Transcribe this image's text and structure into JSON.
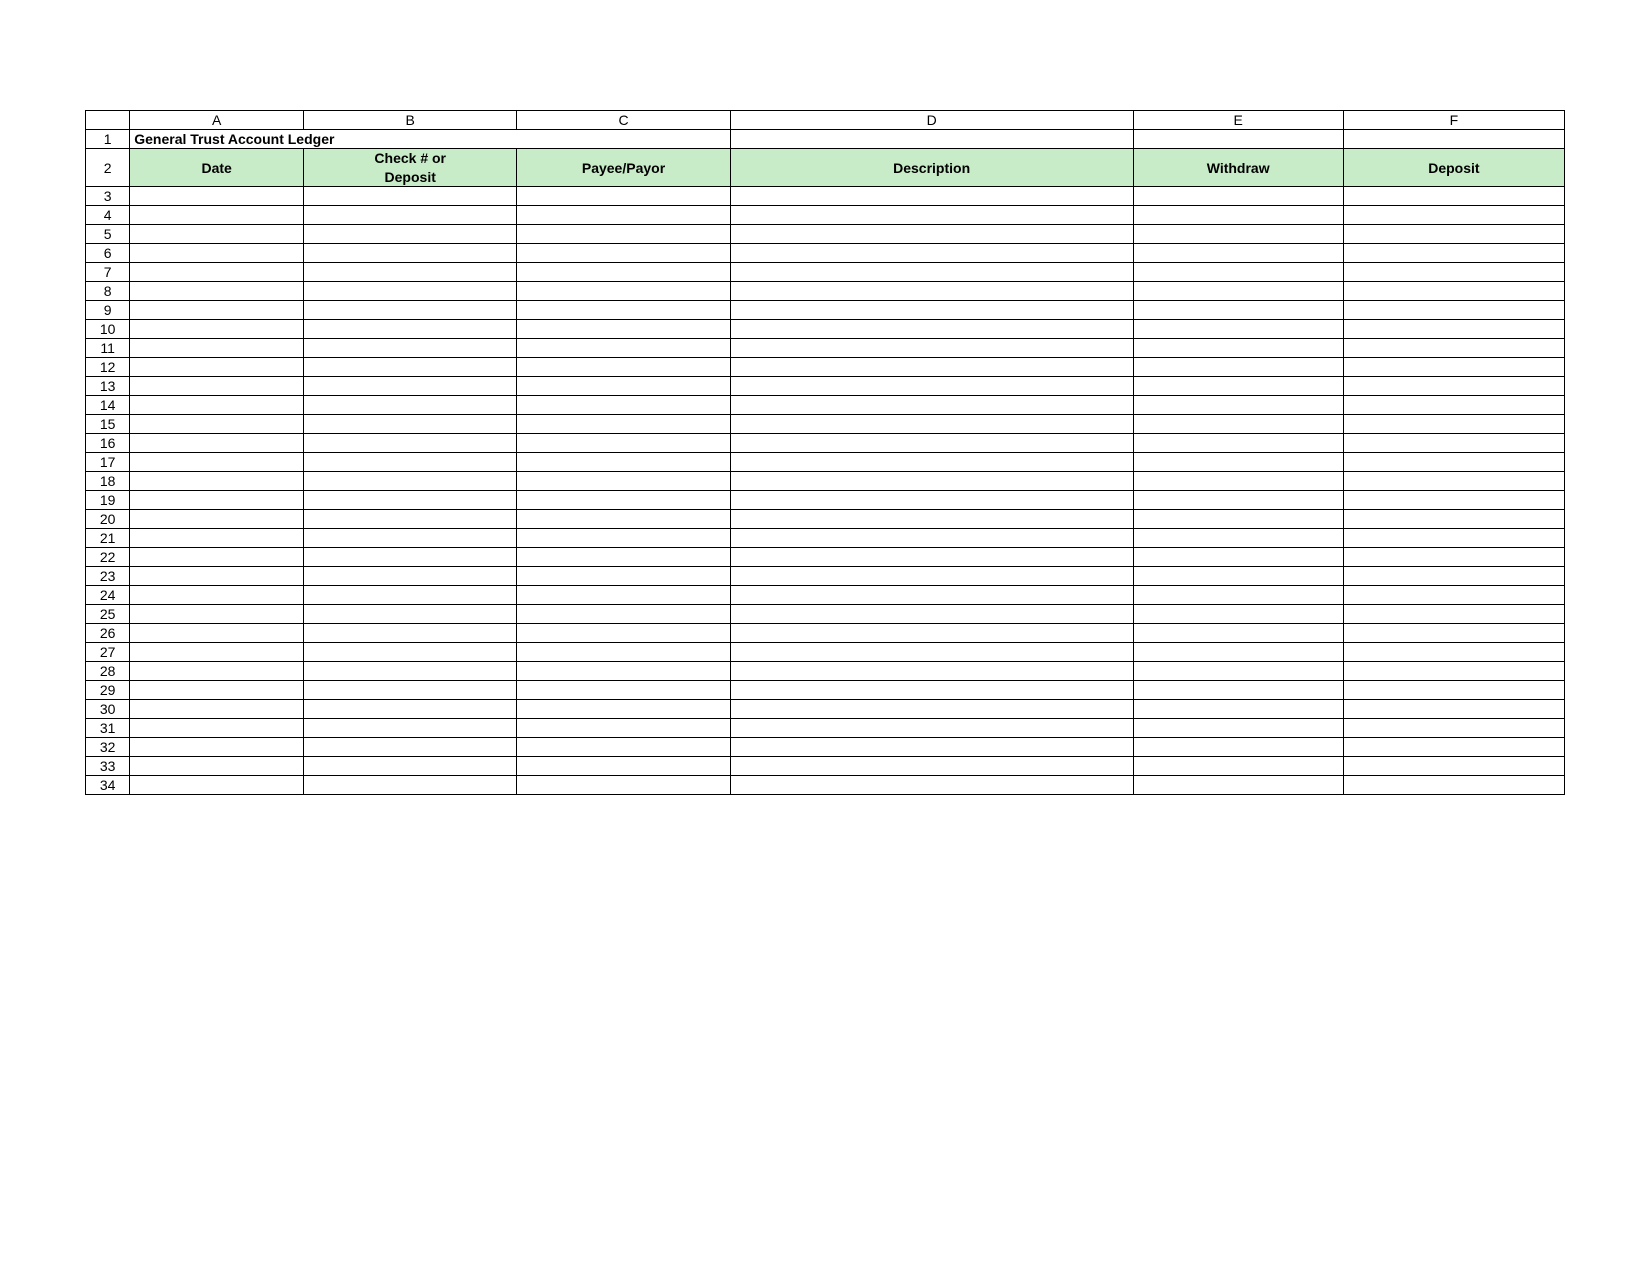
{
  "columns": [
    "A",
    "B",
    "C",
    "D",
    "E",
    "F"
  ],
  "title": "General Trust Account Ledger",
  "headers": {
    "A": "Date",
    "B_top": "Check # or",
    "B_bot": "Deposit",
    "C": "Payee/Payor",
    "D": "Description",
    "E": "Withdraw",
    "F": "Deposit"
  },
  "row_start": 1,
  "row_end": 34,
  "data_rows": []
}
